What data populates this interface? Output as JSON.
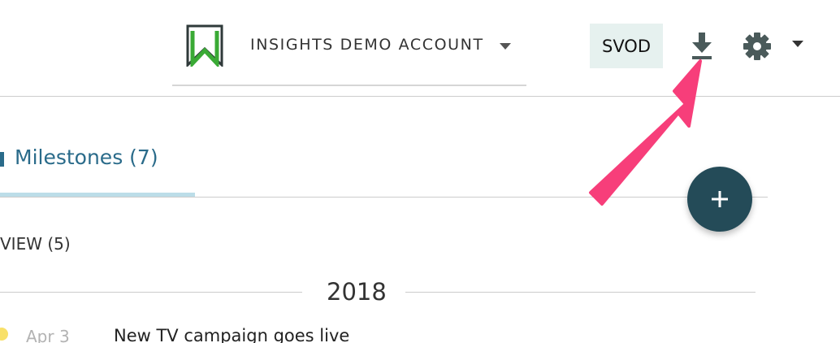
{
  "header": {
    "account_name": "INSIGHTS DEMO ACCOUNT",
    "badge": "SVOD",
    "icons": {
      "logo": "bookmark-logo-icon",
      "account_menu": "caret-down-icon",
      "download": "download-icon",
      "settings": "gear-icon",
      "settings_menu": "caret-down-icon"
    }
  },
  "tabs": {
    "active": {
      "label": "Milestones (7)"
    }
  },
  "fab": {
    "icon": "plus-icon"
  },
  "section": {
    "label": "VIEW (5)"
  },
  "timeline": {
    "year": "2018",
    "items": [
      {
        "date": "Apr 3",
        "title": "New TV campaign goes live",
        "dot_color": "#f8e069"
      }
    ]
  },
  "annotation": {
    "icon": "pointer-arrow-icon",
    "color": "#f73e7a"
  },
  "colors": {
    "accent": "#2a6b8a",
    "fab": "#244b58",
    "badge_bg": "#e6f1ef",
    "logo_green": "#3aaa35",
    "logo_dark": "#2f3a3a"
  }
}
